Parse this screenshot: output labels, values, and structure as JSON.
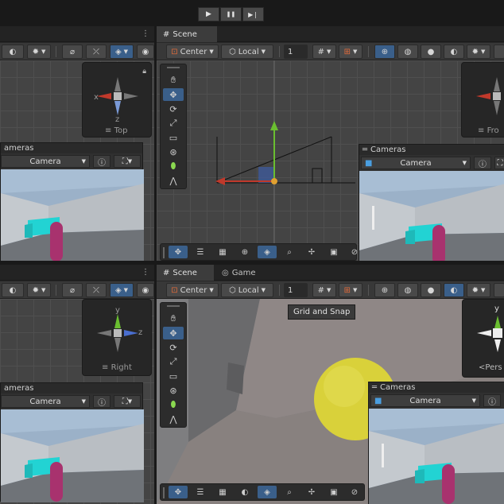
{
  "playbar": {
    "play_icon": "play-icon",
    "pause_icon": "pause-icon",
    "step_icon": "step-icon",
    "play_glyph": "▶",
    "pause_glyph": "❚❚",
    "step_glyph": "▶❘"
  },
  "colors": {
    "accent": "#3a5f8a",
    "gizmo_x": "#c0392b",
    "gizmo_y": "#6abe30",
    "gizmo_z": "#4a6fd0",
    "sphere": "#d9d13a",
    "cyan_object": "#22d3d3",
    "magenta_object": "#a8326e"
  },
  "top_right": {
    "tabs": [
      {
        "label": "Scene",
        "icon": "grid-icon"
      }
    ],
    "toolbar": {
      "pivot": "Center",
      "space": "Local",
      "snap_value": "1"
    },
    "gizmo_label": "Fro",
    "camera": {
      "title": "Cameras",
      "selected": "Camera"
    }
  },
  "bottom_right": {
    "tabs": [
      {
        "label": "Scene",
        "icon": "grid-icon"
      },
      {
        "label": "Game",
        "icon": "gamepad-icon"
      }
    ],
    "toolbar": {
      "pivot": "Center",
      "space": "Local",
      "snap_value": "1"
    },
    "tooltip": "Grid and Snap",
    "gizmo_label": "Pers",
    "gizmo_axis": "y",
    "camera": {
      "title": "Cameras",
      "selected": "Camera"
    }
  },
  "top_left": {
    "gizmo_label": "Top",
    "gizmo_axes": {
      "x": "x",
      "z": "z"
    },
    "camera": {
      "title": "ameras",
      "selected": "Camera"
    }
  },
  "bottom_left": {
    "gizmo_label": "Right",
    "gizmo_axes": {
      "y": "y",
      "z": "z"
    },
    "camera": {
      "title": "ameras",
      "selected": "Camera"
    }
  }
}
